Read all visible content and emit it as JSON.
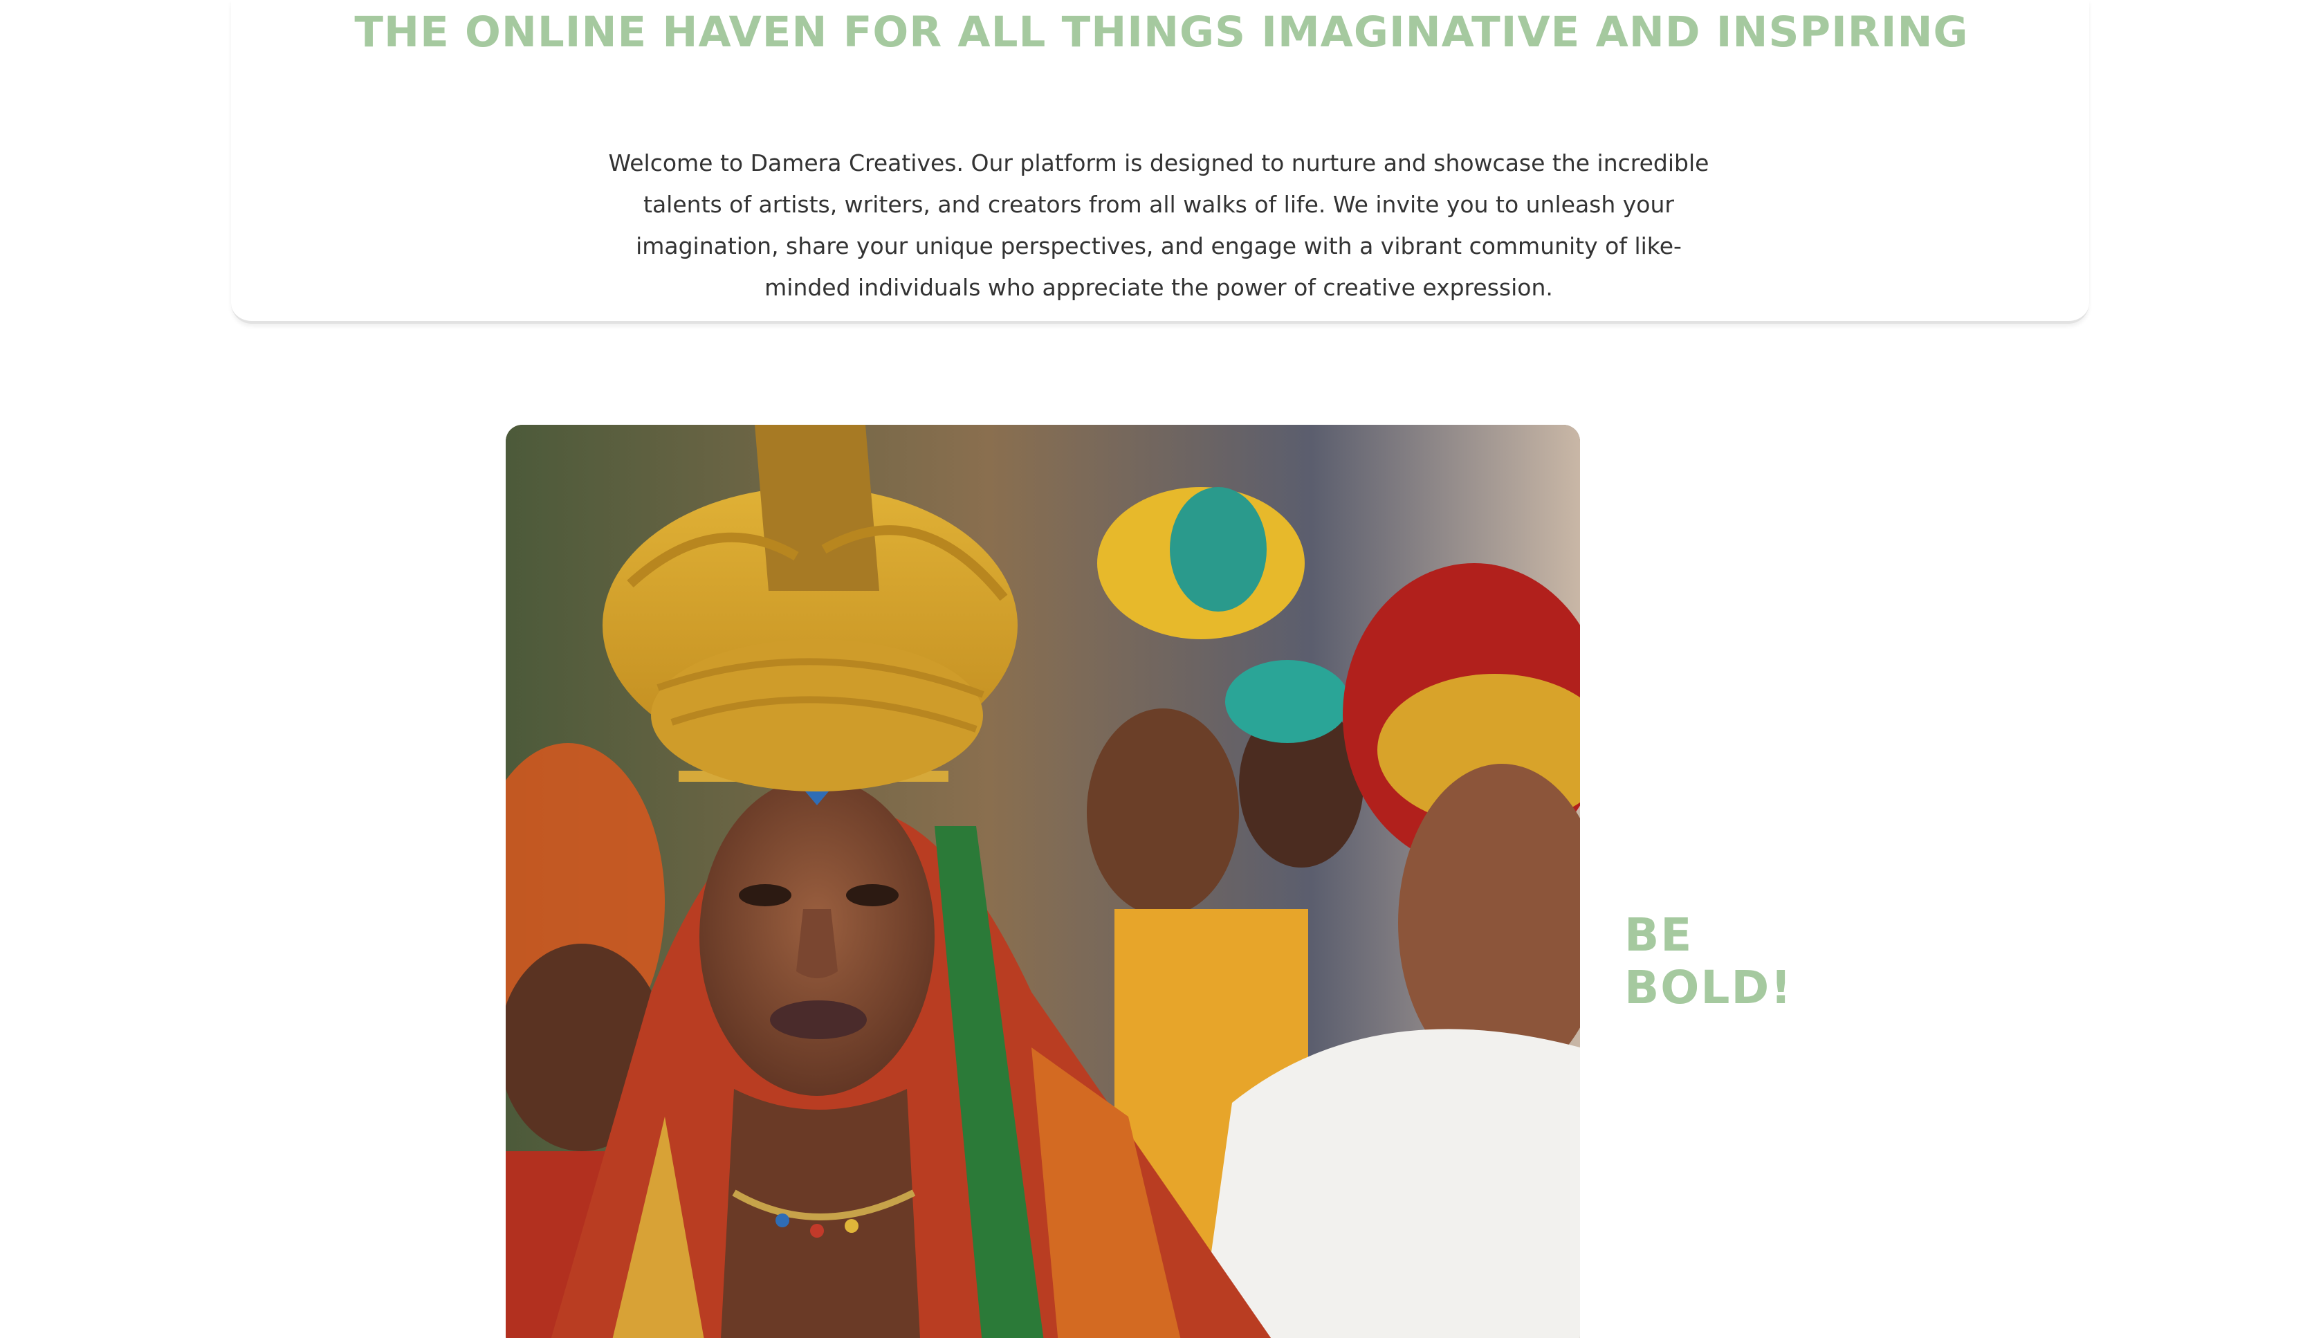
{
  "header": {
    "headline": "THE ONLINE HAVEN FOR ALL THINGS IMAGINATIVE AND INSPIRING"
  },
  "intro": {
    "text": "Welcome to Damera Creatives. Our platform is designed to nurture and showcase the incredible talents of artists, writers, and creators from all walks of life. We invite you to unleash your imagination, share your unique perspectives, and engage with a vibrant community of like-minded individuals who appreciate the power of creative expression."
  },
  "feature": {
    "tagline_line1": "BE",
    "tagline_line2": "BOLD!"
  },
  "colors": {
    "accent": "#a5c99f",
    "text": "#333333",
    "background": "#ffffff"
  }
}
